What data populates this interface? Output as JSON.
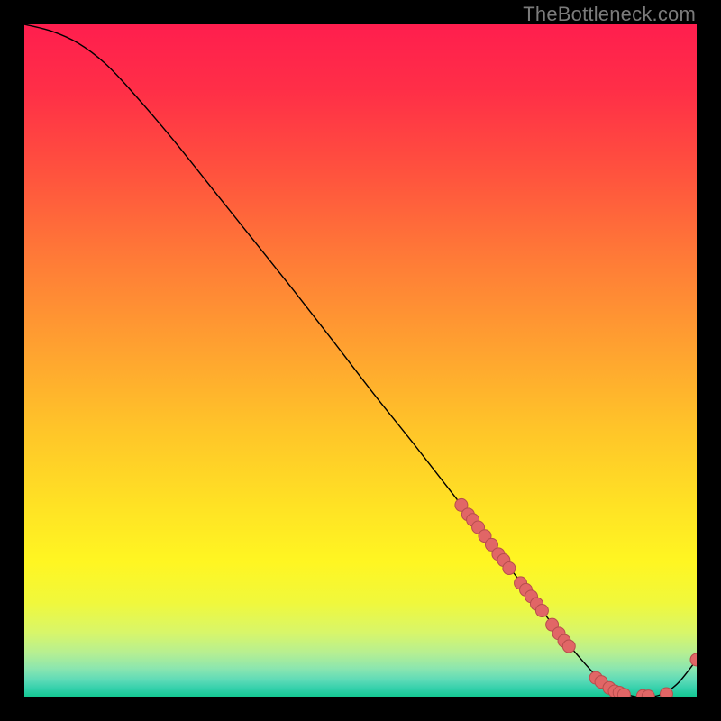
{
  "watermark": "TheBottleneck.com",
  "chart_data": {
    "type": "line",
    "title": "",
    "xlabel": "",
    "ylabel": "",
    "xlim": [
      0,
      100
    ],
    "ylim": [
      0,
      100
    ],
    "grid": false,
    "legend": false,
    "series": [
      {
        "name": "curve",
        "x": [
          0,
          4,
          8,
          12,
          16,
          22,
          28,
          34,
          40,
          46,
          52,
          58,
          64,
          70,
          74,
          78,
          82,
          86,
          90,
          94,
          97,
          100
        ],
        "y": [
          100,
          99,
          97.2,
          94.2,
          90,
          83,
          75.5,
          68,
          60.5,
          52.8,
          45,
          37.5,
          29.8,
          22,
          16.8,
          11.5,
          6.5,
          2.3,
          0.2,
          0.1,
          1.8,
          5.5
        ],
        "markers": [
          {
            "x": 65,
            "y": 28.5
          },
          {
            "x": 66,
            "y": 27.1
          },
          {
            "x": 66.7,
            "y": 26.3
          },
          {
            "x": 67.5,
            "y": 25.2
          },
          {
            "x": 68.5,
            "y": 23.9
          },
          {
            "x": 69.5,
            "y": 22.6
          },
          {
            "x": 70.5,
            "y": 21.2
          },
          {
            "x": 71.3,
            "y": 20.3
          },
          {
            "x": 72.1,
            "y": 19.1
          },
          {
            "x": 73.8,
            "y": 16.9
          },
          {
            "x": 74.6,
            "y": 15.9
          },
          {
            "x": 75.4,
            "y": 14.9
          },
          {
            "x": 76.2,
            "y": 13.8
          },
          {
            "x": 77,
            "y": 12.8
          },
          {
            "x": 78.5,
            "y": 10.7
          },
          {
            "x": 79.5,
            "y": 9.4
          },
          {
            "x": 80.3,
            "y": 8.3
          },
          {
            "x": 81,
            "y": 7.5
          },
          {
            "x": 85,
            "y": 2.8
          },
          {
            "x": 85.8,
            "y": 2.2
          },
          {
            "x": 87,
            "y": 1.3
          },
          {
            "x": 87.8,
            "y": 0.8
          },
          {
            "x": 88.5,
            "y": 0.6
          },
          {
            "x": 89.2,
            "y": 0.3
          },
          {
            "x": 92,
            "y": 0.1
          },
          {
            "x": 92.8,
            "y": 0.05
          },
          {
            "x": 95.5,
            "y": 0.4
          },
          {
            "x": 100,
            "y": 5.5
          }
        ]
      }
    ],
    "background_gradient": {
      "type": "vertical",
      "stops": [
        {
          "pos": 0.0,
          "color": "#ff1e4e"
        },
        {
          "pos": 0.1,
          "color": "#ff2f47"
        },
        {
          "pos": 0.22,
          "color": "#ff523e"
        },
        {
          "pos": 0.35,
          "color": "#ff7b37"
        },
        {
          "pos": 0.48,
          "color": "#ffa130"
        },
        {
          "pos": 0.6,
          "color": "#ffc429"
        },
        {
          "pos": 0.72,
          "color": "#ffe324"
        },
        {
          "pos": 0.8,
          "color": "#fff622"
        },
        {
          "pos": 0.86,
          "color": "#f0f83c"
        },
        {
          "pos": 0.905,
          "color": "#d8f66a"
        },
        {
          "pos": 0.935,
          "color": "#b6ef92"
        },
        {
          "pos": 0.958,
          "color": "#8be6af"
        },
        {
          "pos": 0.975,
          "color": "#5edbb7"
        },
        {
          "pos": 0.988,
          "color": "#34d0ab"
        },
        {
          "pos": 1.0,
          "color": "#14c892"
        }
      ]
    },
    "marker_style": {
      "fill": "#e16666",
      "stroke": "#b74d4d",
      "r": 7
    },
    "line_style": {
      "stroke": "#000000",
      "width": 1.4
    }
  }
}
